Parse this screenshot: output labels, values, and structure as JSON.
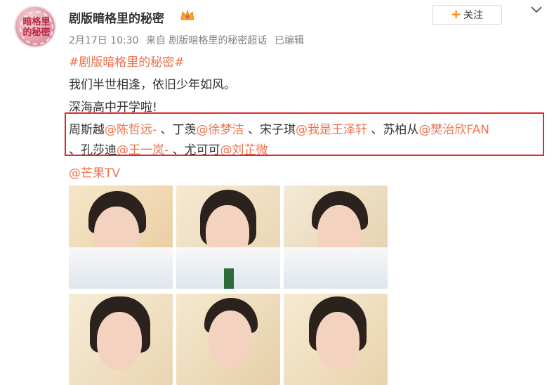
{
  "post": {
    "author": "剧版暗格里的秘密",
    "follow_label": "关注",
    "date": "2月17日 10:30",
    "source": "来自 剧版暗格里的秘密超话",
    "edited": "已编辑",
    "hashtag": "#剧版暗格里的秘密#",
    "line1": "我们半世相逢，依旧少年如风。",
    "line2": "深海高中开学啦!",
    "cast_line1": [
      {
        "name": "周斯越",
        "mention": "@陈哲远-"
      },
      {
        "name": "、丁羡",
        "mention": "@徐梦洁"
      },
      {
        "name": "、宋子琪",
        "mention": "@我是王泽轩"
      },
      {
        "name": "、苏柏从",
        "mention": "@樊治欣FAN"
      }
    ],
    "cast_line2": [
      {
        "name": "、孔莎迪",
        "mention": "@王一岚-"
      },
      {
        "name": "、尤可可",
        "mention": "@刘芷微"
      }
    ],
    "tail_mention": "@芒果TV"
  },
  "avatar": {
    "text": "暗格里的秘密"
  },
  "icons": {
    "crown": "crown-icon",
    "follow": "plus-icon",
    "menu": "chevron-down-icon"
  },
  "colors": {
    "mention": "#eb7350",
    "highlight_box": "#e0292e",
    "accent": "#ff8200"
  }
}
